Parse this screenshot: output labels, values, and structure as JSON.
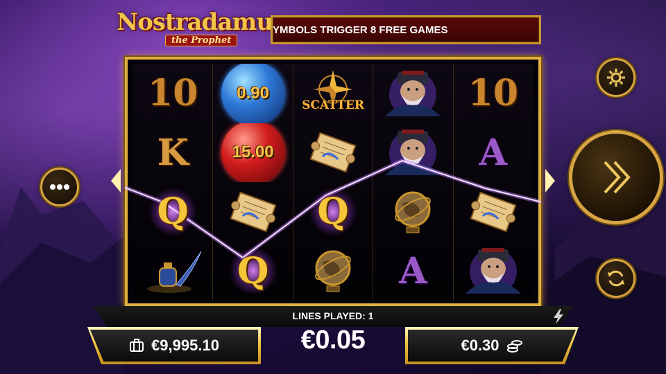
{
  "game": {
    "logo_title": "Nostradamus",
    "logo_subtitle": "the Prophet"
  },
  "message_bar": {
    "text": "YMBOLS TRIGGER 8 FREE GAMES"
  },
  "reels": [
    {
      "symbols": [
        {
          "type": "card",
          "label": "10",
          "style": "card-10"
        },
        {
          "type": "card",
          "label": "K",
          "style": "card-k"
        },
        {
          "type": "card",
          "label": "Q",
          "style": "card-q",
          "glow": true
        },
        {
          "type": "icon",
          "name": "inkwell-quill"
        }
      ]
    },
    {
      "symbols": [
        {
          "type": "orb",
          "color": "blue",
          "label": "0.90"
        },
        {
          "type": "orb",
          "color": "red",
          "label": "15.00"
        },
        {
          "type": "icon",
          "name": "scroll"
        },
        {
          "type": "card",
          "label": "Q",
          "style": "card-q",
          "glow": true
        }
      ]
    },
    {
      "symbols": [
        {
          "type": "scatter",
          "label": "SCATTER"
        },
        {
          "type": "icon",
          "name": "scroll"
        },
        {
          "type": "card",
          "label": "Q",
          "style": "card-q",
          "glow": true
        },
        {
          "type": "icon",
          "name": "globe"
        }
      ]
    },
    {
      "symbols": [
        {
          "type": "icon",
          "name": "nostradamus-portrait"
        },
        {
          "type": "icon",
          "name": "nostradamus-portrait"
        },
        {
          "type": "icon",
          "name": "globe"
        },
        {
          "type": "card",
          "label": "A",
          "style": "card-a"
        }
      ]
    },
    {
      "symbols": [
        {
          "type": "card",
          "label": "10",
          "style": "card-10"
        },
        {
          "type": "card",
          "label": "A",
          "style": "card-a"
        },
        {
          "type": "icon",
          "name": "scroll"
        },
        {
          "type": "icon",
          "name": "nostradamus-portrait"
        }
      ]
    }
  ],
  "controls": {
    "settings_icon": "gear-icon",
    "spin_icon": "double-chevron-right-icon",
    "autoplay_icon": "refresh-icon",
    "menu_icon": "ellipsis-icon"
  },
  "bottom": {
    "lines_played": "LINES PLAYED: 1",
    "bet": "€0.05",
    "balance": "€9,995.10",
    "stake": "€0.30",
    "balance_icon": "briefcase-icon",
    "stake_icon": "coins-icon",
    "turbo_icon": "lightning-icon"
  },
  "colors": {
    "gold": "#e0b040",
    "payline": "#d6a0ff",
    "message_bg": "#5a0a0a"
  }
}
